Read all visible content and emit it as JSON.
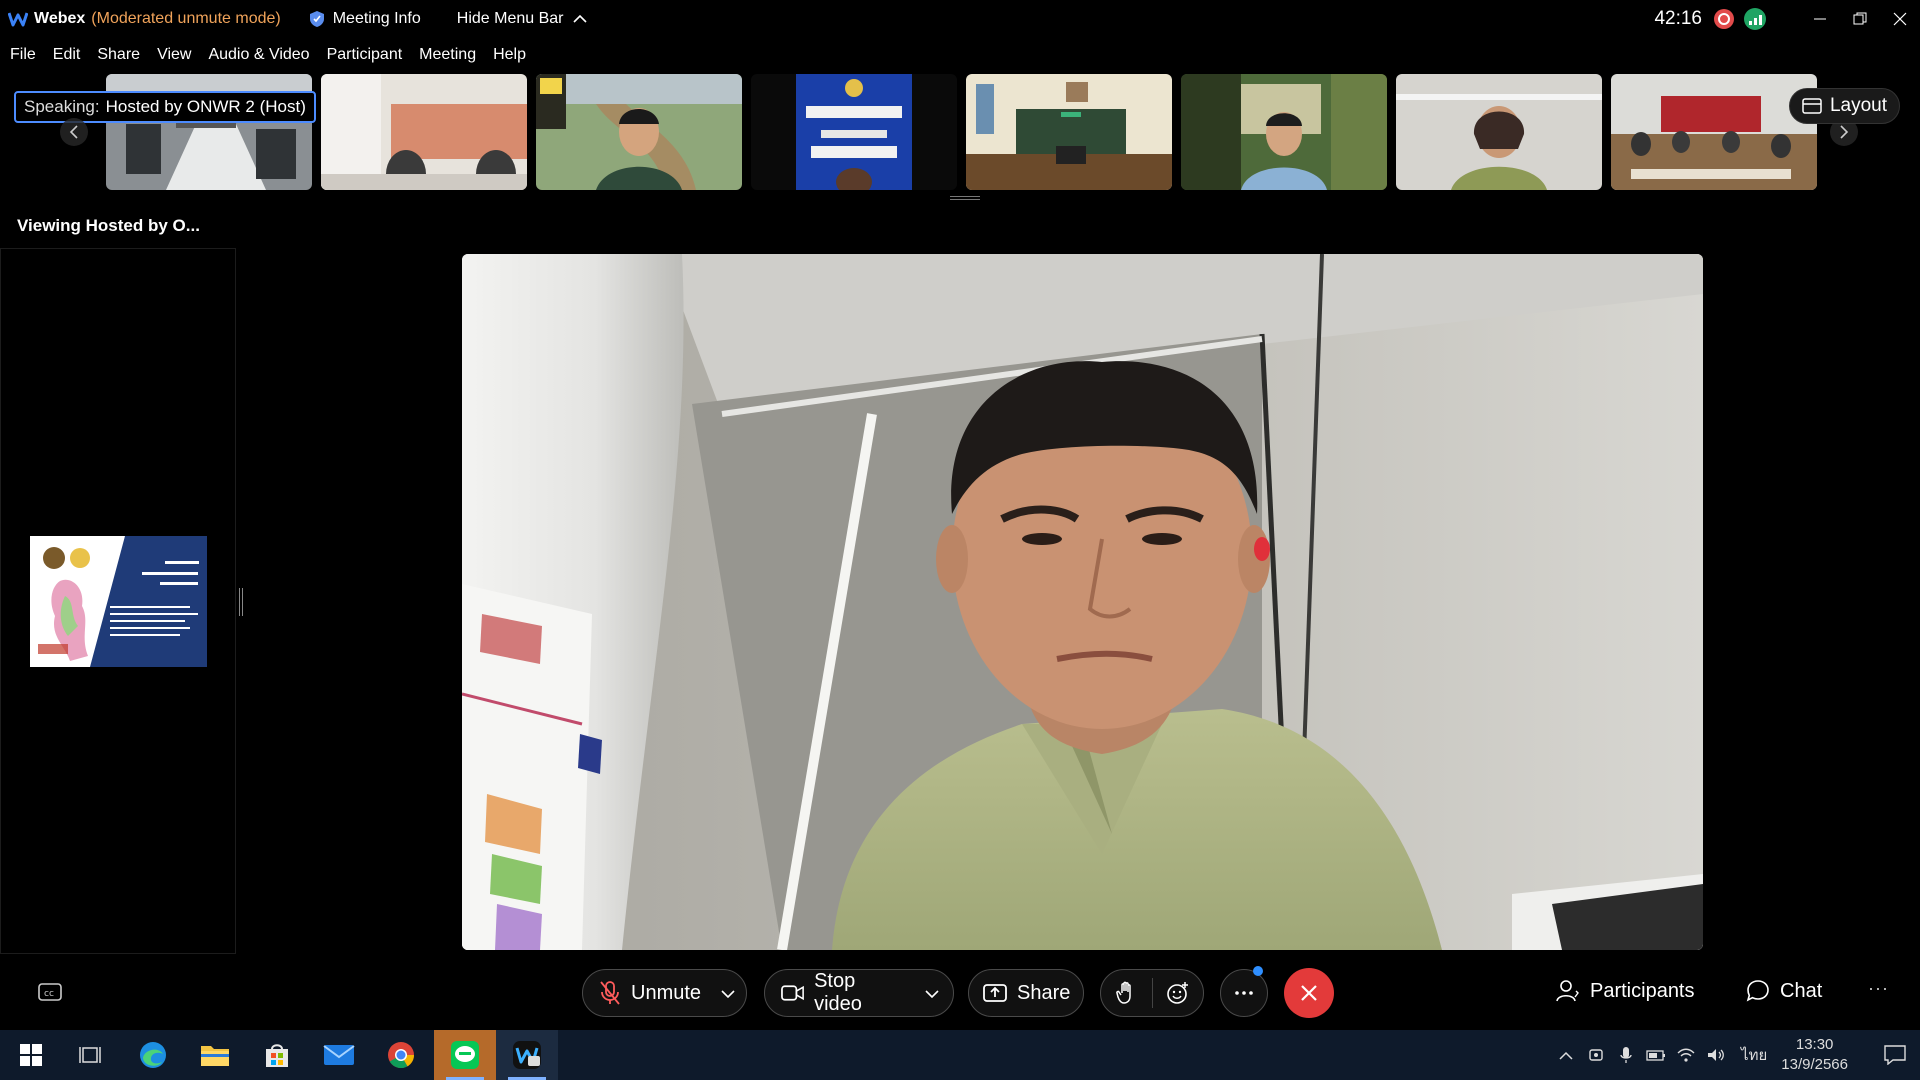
{
  "titlebar": {
    "app_name": "Webex",
    "mode": "(Moderated unmute mode)",
    "meeting_info": "Meeting Info",
    "hide_menu": "Hide Menu Bar",
    "timer": "42:16",
    "mode_color": "#f0a35a"
  },
  "menu": [
    "File",
    "Edit",
    "Share",
    "View",
    "Audio & Video",
    "Participant",
    "Meeting",
    "Help"
  ],
  "filmstrip": {
    "speaking_label": "Speaking:",
    "speaking_name": "Hosted by ONWR 2 (Host)",
    "layout_label": "Layout"
  },
  "viewing_label": "Viewing Hosted by O...",
  "controls": {
    "unmute": "Unmute",
    "stop_video": "Stop video",
    "share": "Share",
    "participants": "Participants",
    "chat": "Chat",
    "more": "···",
    "end_color": "#e33a3a"
  },
  "taskbar": {
    "lang": "ไทย",
    "time": "13:30",
    "date": "13/9/2566"
  }
}
